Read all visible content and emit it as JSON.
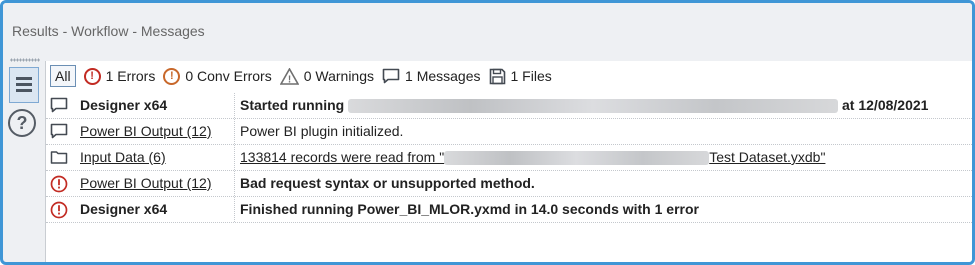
{
  "window": {
    "title": "Results - Workflow - Messages"
  },
  "filters": {
    "all_label": "All",
    "errors_label": "1 Errors",
    "conv_errors_label": "0 Conv Errors",
    "warnings_label": "0 Warnings",
    "messages_label": "1 Messages",
    "files_label": "1 Files"
  },
  "colors": {
    "accent": "#3f96d6",
    "error": "#c0231a",
    "link": "#1b3fb5",
    "conv_error": "#c8682b"
  },
  "rows": [
    {
      "icon": "message-icon",
      "tool": "Designer x64",
      "message_prefix": "Started running",
      "message_suffix": "at 12/08/2021"
    },
    {
      "icon": "message-icon",
      "tool": "Power BI Output (12)",
      "message": "Power BI plugin initialized."
    },
    {
      "icon": "file-icon",
      "tool": "Input Data (6)",
      "message_prefix": "133814 records were read from \"",
      "message_suffix": "Test Dataset.yxdb\""
    },
    {
      "icon": "error-icon",
      "tool": "Power BI Output (12)",
      "message": "Bad request syntax or unsupported method."
    },
    {
      "icon": "error-icon",
      "tool": "Designer x64",
      "message": "Finished running Power_BI_MLOR.yxmd in 14.0 seconds with 1 error"
    }
  ]
}
